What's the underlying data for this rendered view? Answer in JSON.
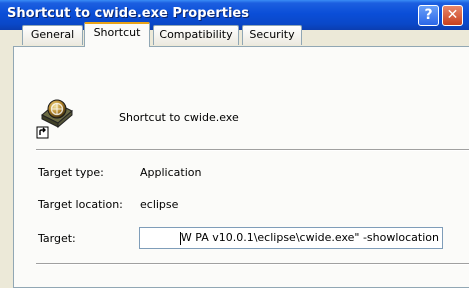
{
  "window": {
    "title": "Shortcut to cwide.exe Properties",
    "help_label": "?",
    "close_label": "✕"
  },
  "tabs": [
    {
      "label": "General"
    },
    {
      "label": "Shortcut"
    },
    {
      "label": "Compatibility"
    },
    {
      "label": "Security"
    }
  ],
  "shortcut": {
    "name": "Shortcut to cwide.exe",
    "icon": "eclipse-shortcut-icon",
    "target_type_label": "Target type:",
    "target_type_value": "Application",
    "target_location_label": "Target location:",
    "target_location_value": "eclipse",
    "target_label": "Target:",
    "target_value": "W PA v10.0.1\\eclipse\\cwide.exe\" -showlocation"
  }
}
